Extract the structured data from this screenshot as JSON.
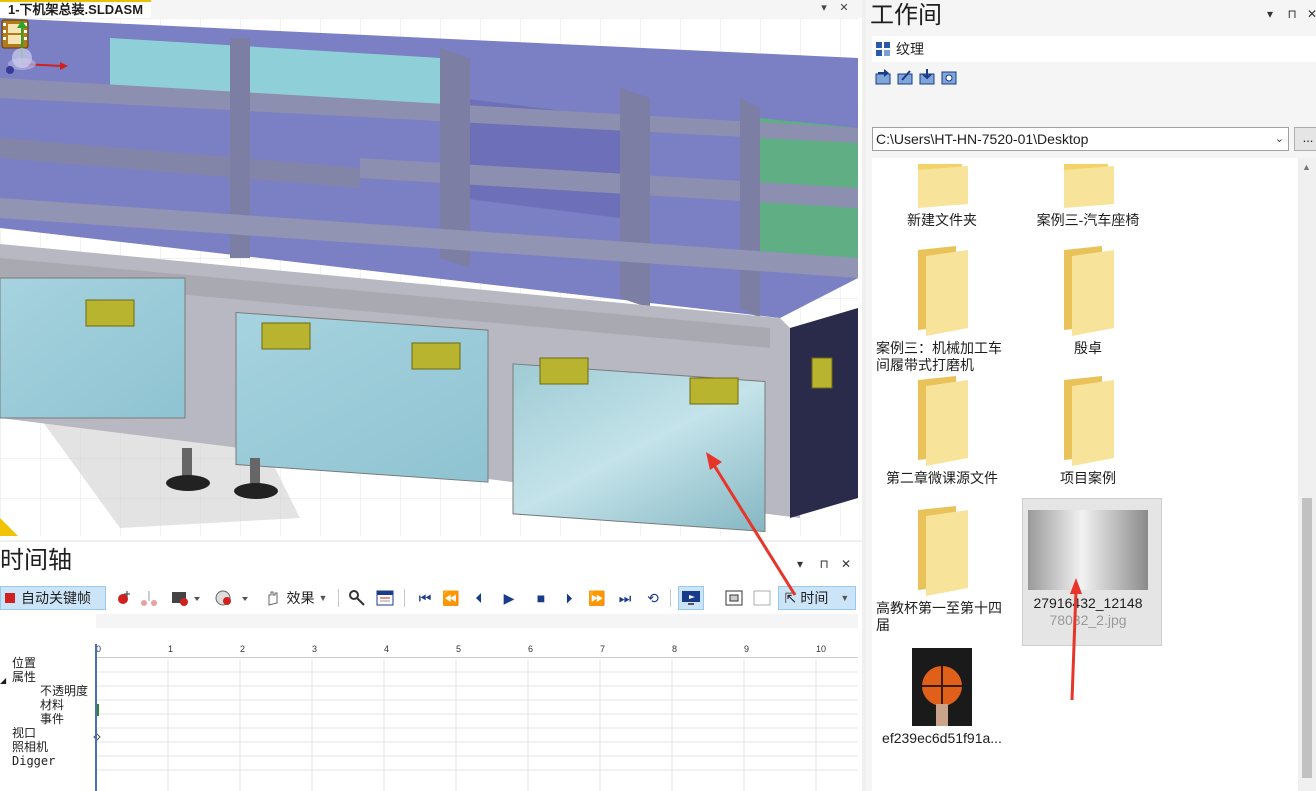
{
  "viewport": {
    "document_tab": "1-下机架总装.SLDASM",
    "tab_dropdown": "▾",
    "tab_close": "✕"
  },
  "timeline": {
    "title": "时间轴",
    "ctrl_dropdown": "▾",
    "ctrl_pin": "⊓",
    "ctrl_close": "✕",
    "autokey_label": "自动关键帧",
    "effects_label": "效果",
    "time_label": "时间",
    "ruler_ticks": [
      "0",
      "1",
      "2",
      "3",
      "4",
      "5",
      "6",
      "7",
      "8",
      "9",
      "10"
    ],
    "tracks": [
      {
        "label": "位置",
        "indent": 0
      },
      {
        "label": "属性",
        "indent": 0,
        "expanded": true
      },
      {
        "label": "不透明度",
        "indent": 2
      },
      {
        "label": "材料",
        "indent": 2
      },
      {
        "label": "事件",
        "indent": 2
      },
      {
        "label": "视口",
        "indent": 0
      },
      {
        "label": "照相机",
        "indent": 0
      },
      {
        "label": "Digger",
        "indent": 0
      }
    ],
    "expander": "◢"
  },
  "workspace": {
    "title": "工作间",
    "ctrl_dropdown": "▾",
    "ctrl_pin": "⊓",
    "ctrl_close": "✕",
    "texture_label": "纹理",
    "path": "C:\\Users\\HT-HN-7520-01\\Desktop",
    "path_caret": "⌄",
    "browse_label": "...",
    "scroll_up": "▲",
    "files": [
      {
        "name": "新建文件夹",
        "type": "folder"
      },
      {
        "name": "案例三-汽车座椅",
        "type": "folder"
      },
      {
        "name": "案例三：机械加工车间履带式打磨机",
        "type": "folder"
      },
      {
        "name": "殷卓",
        "type": "folder"
      },
      {
        "name": "第二章微课源文件",
        "type": "folder"
      },
      {
        "name": "项目案例",
        "type": "folder"
      },
      {
        "name": "高教杯第一至第十四届",
        "type": "folder"
      },
      {
        "name": "27916432_121487878032_2.jpg",
        "type": "image",
        "selected": true
      },
      {
        "name": "ef239ec6d51f91a...",
        "type": "image"
      }
    ],
    "selected_name_line1": "27916432_12148",
    "selected_name_line2": "78032_2.jpg"
  },
  "colors": {
    "accent_selected": "#cce4f7",
    "folder_yellow": "#f4d26a",
    "annotation_red": "#e8352a"
  }
}
